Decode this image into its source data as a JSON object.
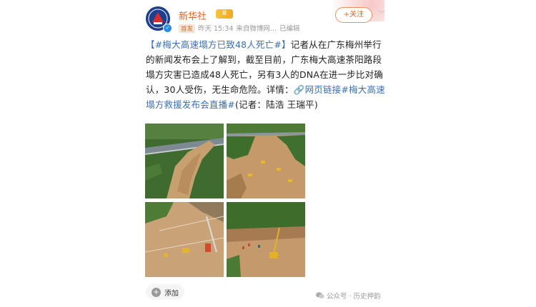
{
  "account": {
    "name": "新华社",
    "level_badge": "Ⅲ",
    "verified_icon": "v-check-icon"
  },
  "meta": {
    "tag": "首发",
    "time": "昨天 15:34",
    "source": "来自微博网...",
    "edited": "已编辑"
  },
  "follow_label": "+关注",
  "post": {
    "hashtag": "【#梅大高速塌方已致48人死亡#】",
    "body": "记者从在广东梅州举行的新闻发布会上了解到，截至目前，广东梅大高速茶阳路段塌方灾害已造成48人死亡，另有3人的DNA在进一步比对确认，30人受伤，无生命危险。详情：",
    "link_text": "🔗网页链接",
    "hashtag2": "#梅大高速塌方救援发布会直播#",
    "reporter": "(记者：陆浩 王瑞平)"
  },
  "photos": [
    {
      "label": "aerial-highway-collapse-icon"
    },
    {
      "label": "aerial-landslide-excavators-icon"
    },
    {
      "label": "aerial-rescue-site-icon"
    },
    {
      "label": "aerial-crane-rescue-icon"
    }
  ],
  "actions": {
    "add_label": "添加"
  },
  "watermark": {
    "text": "公众号 · 历史押韵"
  },
  "colors": {
    "accent": "#e8631f",
    "link": "#3b6fb6",
    "meta_gray": "#999999"
  }
}
